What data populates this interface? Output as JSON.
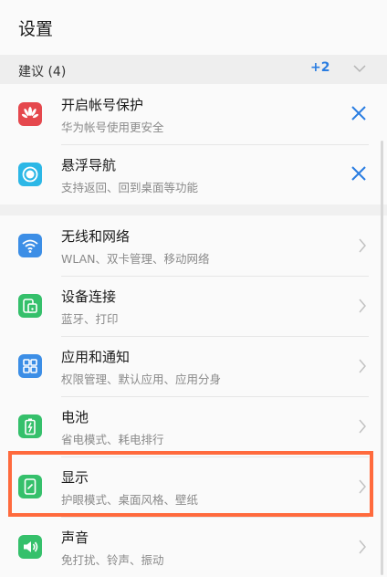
{
  "header": {
    "title": "设置"
  },
  "suggestions": {
    "label": "建议 (4)",
    "more": "+2",
    "items": [
      {
        "title": "开启帐号保护",
        "subtitle": "华为帐号使用更安全",
        "icon": "huawei-logo-icon",
        "color": "#e5484d"
      },
      {
        "title": "悬浮导航",
        "subtitle": "支持返回、回到桌面等功能",
        "icon": "floating-nav-icon",
        "color": "#2cb7e6"
      }
    ]
  },
  "settings": [
    {
      "title": "无线和网络",
      "subtitle": "WLAN、双卡管理、移动网络",
      "icon": "wifi-icon",
      "color": "#3c8ee6"
    },
    {
      "title": "设备连接",
      "subtitle": "蓝牙、打印",
      "icon": "device-connect-icon",
      "color": "#35c06b"
    },
    {
      "title": "应用和通知",
      "subtitle": "权限管理、默认应用、应用分身",
      "icon": "apps-grid-icon",
      "color": "#3c8ee6"
    },
    {
      "title": "电池",
      "subtitle": "省电模式、耗电排行",
      "icon": "battery-icon",
      "color": "#35c06b"
    },
    {
      "title": "显示",
      "subtitle": "护眼模式、桌面风格、壁纸",
      "icon": "display-icon",
      "color": "#35c06b"
    },
    {
      "title": "声音",
      "subtitle": "免打扰、铃声、振动",
      "icon": "sound-icon",
      "color": "#35c06b"
    }
  ],
  "colors": {
    "accent": "#2a7de1",
    "highlight": "#ff6a3d"
  }
}
